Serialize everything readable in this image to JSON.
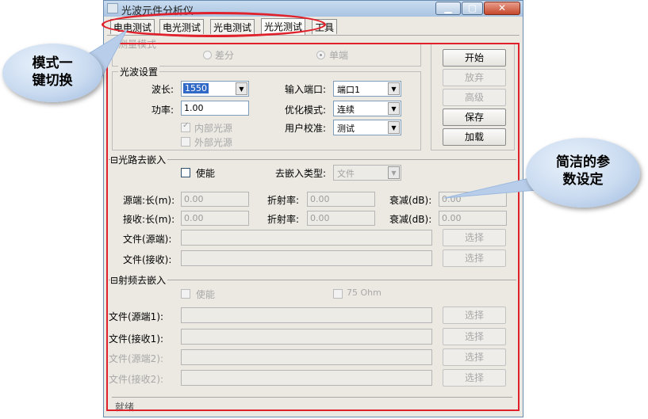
{
  "window": {
    "title": "光波元件分析仪",
    "buttons": {
      "minimize": "▁",
      "maximize": "▢",
      "close": "✕"
    }
  },
  "tabs": [
    "电电测试",
    "电光测试",
    "光电测试",
    "光光测试",
    "工具"
  ],
  "test_mode": {
    "label": "测量模式",
    "options": [
      "差分",
      "单端"
    ],
    "selected": "单端"
  },
  "optical": {
    "group": "光波设置",
    "wavelength_label": "波长:",
    "wavelength_value": "1550",
    "power_label": "功率:",
    "power_value": "1.00",
    "internal_source": "内部光源",
    "external_source": "外部光源",
    "input_port_label": "输入端口:",
    "input_port_value": "端口1",
    "opt_mode_label": "优化模式:",
    "opt_mode_value": "连续",
    "user_cal_label": "用户校准:",
    "user_cal_value": "测试"
  },
  "actions": {
    "start": "开始",
    "discard": "放弃",
    "advanced": "高级",
    "save": "保存",
    "load": "加载"
  },
  "deembed": {
    "group": "光路去嵌入",
    "enable": "使能",
    "type_label": "去嵌入类型:",
    "type_value": "文件",
    "src_len_label": "源端:长(m):",
    "src_len_value": "0.00",
    "src_ri_label": "折射率:",
    "src_ri_value": "0.00",
    "src_att_label": "衰减(dB):",
    "src_att_value": "0.00",
    "rcv_len_label": "接收:长(m):",
    "rcv_len_value": "0.00",
    "rcv_ri_label": "折射率:",
    "rcv_ri_value": "0.00",
    "rcv_att_label": "衰减(dB):",
    "rcv_att_value": "0.00",
    "file_src_label": "文件(源端):",
    "file_rcv_label": "文件(接收):",
    "browse": "选择"
  },
  "rf_deembed": {
    "group": "射频去嵌入",
    "enable": "使能",
    "ohm": "75 Ohm",
    "file1_label": "文件(源端1):",
    "file2_label": "文件(接收1):",
    "file3_label": "文件(源端2):",
    "file4_label": "文件(接收2):",
    "browse": "选择"
  },
  "status": "就绪",
  "annotations": {
    "mode_switch": "模式一键切换",
    "mode_switch_l1": "模式一",
    "mode_switch_l2": "键切换",
    "concise_l1": "简洁的参",
    "concise_l2": "数设定",
    "colors": {
      "highlight": "#e0202a",
      "bubble": "#cadbf0"
    }
  }
}
